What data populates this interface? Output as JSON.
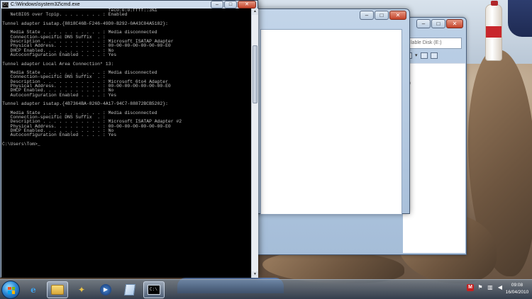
{
  "cmd": {
    "title": "C:\\Windows\\system32\\cmd.exe",
    "icon_text": "C:\\",
    "lines": [
      "                                       fec0:0:0:ffff::3%1",
      "   NetBIOS over Tcpip. . . . . . . . : Enabled",
      "",
      "Tunnel adapter isatap.{8818C46B-F246-49D0-B292-0A43C84A5182}:",
      "",
      "   Media State . . . . . . . . . . . : Media disconnected",
      "   Connection-specific DNS Suffix  . :",
      "   Description . . . . . . . . . . . : Microsoft ISATAP Adapter",
      "   Physical Address. . . . . . . . . : 00-00-00-00-00-00-00-E0",
      "   DHCP Enabled. . . . . . . . . . . : No",
      "   Autoconfiguration Enabled . . . . : Yes",
      "",
      "Tunnel adapter Local Area Connection* 13:",
      "",
      "   Media State . . . . . . . . . . . : Media disconnected",
      "   Connection-specific DNS Suffix  . :",
      "   Description . . . . . . . . . . . : Microsoft 6to4 Adapter",
      "   Physical Address. . . . . . . . . : 00-00-00-00-00-00-00-E0",
      "   DHCP Enabled. . . . . . . . . . . : No",
      "   Autoconfiguration Enabled . . . . : Yes",
      "",
      "Tunnel adapter isatap.{4B7364BA-826D-4A17-94C7-88872BCB5202}:",
      "",
      "   Media State . . . . . . . . . . . : Media disconnected",
      "   Connection-specific DNS Suffix  . :",
      "   Description . . . . . . . . . . . : Microsoft ISATAP Adapter #2",
      "   Physical Address. . . . . . . . . : 00-00-00-00-00-00-00-E0",
      "   DHCP Enabled. . . . . . . . . . . : No",
      "   Autoconfiguration Enabled . . . . : Yes",
      "",
      "C:\\Users\\Tom>_"
    ]
  },
  "explorer_back": {
    "path_text": "lable Disk (E:)",
    "column_header": "ze"
  },
  "window_controls": {
    "minimize": "–",
    "maximize": "□",
    "close": "✕"
  },
  "tray": {
    "icon_m": "M",
    "clock_time": "09:08",
    "clock_date": "16/04/2010"
  },
  "taskbar_icons": [
    "start-orb",
    "ie-icon",
    "folder-icon",
    "tool-icon",
    "media-player-icon",
    "page-icon",
    "cmd-icon"
  ],
  "colors": {
    "console_bg": "#000000",
    "console_text": "#c0c0c0",
    "close_red": "#c4432a"
  }
}
